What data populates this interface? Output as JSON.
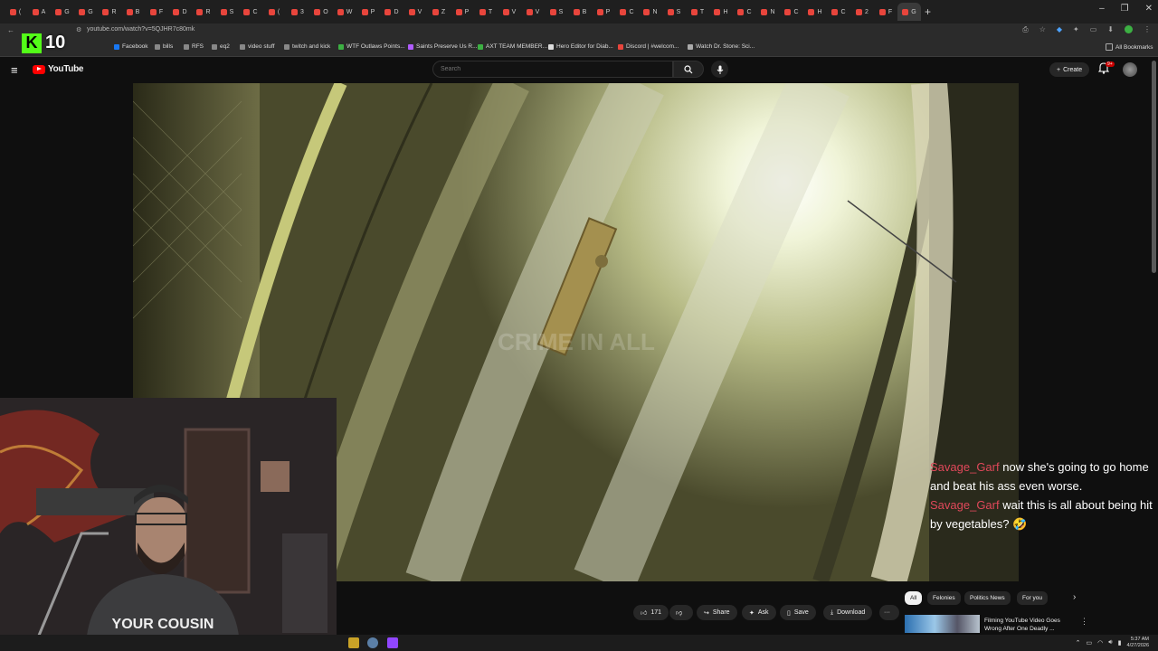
{
  "browser": {
    "tab_letters": [
      "(",
      "A",
      "G",
      "G",
      "R",
      "B",
      "F",
      "D",
      "R",
      "S",
      "C",
      "(",
      "3",
      "O",
      "W",
      "P",
      "D",
      "V",
      "Z",
      "P",
      "T",
      "V",
      "V",
      "S",
      "B",
      "P",
      "C",
      "N",
      "S",
      "T",
      "H",
      "C",
      "N",
      "C",
      "H",
      "C",
      "2",
      "F",
      "G"
    ],
    "new_tab_symbol": "+",
    "window_controls": [
      "–",
      "❐",
      "✕"
    ],
    "url": "youtube.com/watch?v=5QJHR7c80mk",
    "bookmarks": [
      {
        "label": "Facebook",
        "color": "#1877f2"
      },
      {
        "label": "bills",
        "color": "#888888"
      },
      {
        "label": "RFS",
        "color": "#888888"
      },
      {
        "label": "eq2",
        "color": "#888888"
      },
      {
        "label": "video stuff",
        "color": "#888888"
      },
      {
        "label": "twitch and kick",
        "color": "#888888"
      },
      {
        "label": "WTF Outlaws Points...",
        "color": "#3cb043"
      },
      {
        "label": "Saints Preserve Us R...",
        "color": "#b05cff"
      },
      {
        "label": "AXT TEAM MEMBER...",
        "color": "#3cb043"
      },
      {
        "label": "Hero Editor for Diab...",
        "color": "#dddddd"
      },
      {
        "label": "Discord | #welcom...",
        "color": "#e8453c"
      },
      {
        "label": "Watch Dr. Stone: Sci...",
        "color": "#aaaaaa"
      }
    ],
    "all_bookmarks": "All Bookmarks"
  },
  "overlay": {
    "k_letter": "K",
    "k_count": "10"
  },
  "youtube": {
    "logo_text": "YouTube",
    "search_placeholder": "Search",
    "create_label": "Create",
    "notifications_badge": "9+",
    "video_watermark": "CRIME IN ALL",
    "actions": {
      "likes": "171",
      "share": "Share",
      "ask": "Ask",
      "save": "Save",
      "download": "Download",
      "more": "···"
    },
    "chips": [
      "All",
      "Felonies",
      "Politics News",
      "For you"
    ],
    "recommendation": {
      "title": "Filming YouTube Video Goes Wrong After One Deadly ..."
    }
  },
  "chat": [
    {
      "user": "Savage_Garf",
      "message": "now she's going to go home and beat his ass even worse."
    },
    {
      "user": "Savage_Garf",
      "message": "wait this is all about being hit by vegetables? 🤣"
    }
  ],
  "webcam": {
    "shirt_text": "YOUR COUSIN"
  },
  "taskbar": {
    "time": "5:37 AM",
    "date": "4/27/2026"
  }
}
